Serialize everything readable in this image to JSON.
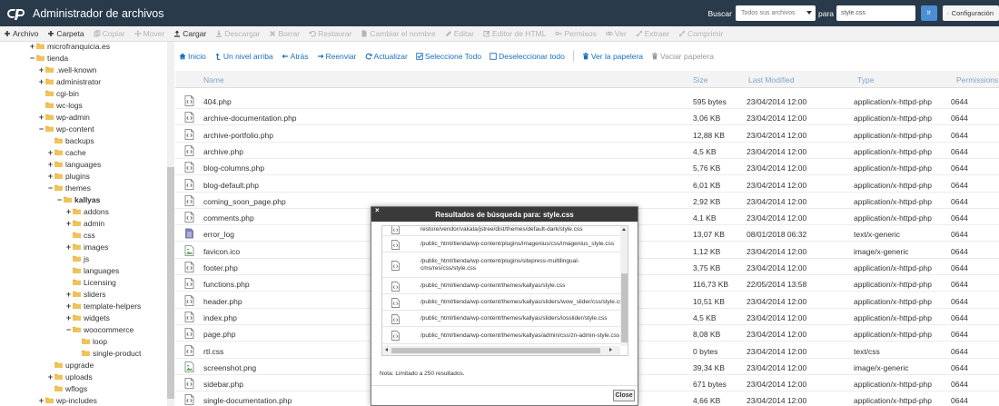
{
  "header": {
    "title": "Administrador de archivos",
    "search_label": "Buscar",
    "search_scope": "Todos sus archivos",
    "para_label": "para",
    "search_value": "style.css",
    "go_label": "Ir",
    "config_label": "Configuración"
  },
  "toolbar": [
    {
      "label": "Archivo",
      "icon": "plus-icon",
      "enabled": true
    },
    {
      "label": "Carpeta",
      "icon": "plus-icon",
      "enabled": true
    },
    {
      "label": "Copiar",
      "icon": "copy-icon",
      "enabled": false
    },
    {
      "label": "Mover",
      "icon": "move-icon",
      "enabled": false
    },
    {
      "label": "Cargar",
      "icon": "upload-icon",
      "enabled": true
    },
    {
      "label": "Descargar",
      "icon": "download-icon",
      "enabled": false
    },
    {
      "label": "Borrar",
      "icon": "x-icon",
      "enabled": false
    },
    {
      "label": "Restaurar",
      "icon": "undo-icon",
      "enabled": false
    },
    {
      "label": "Cambiar el nombre",
      "icon": "file-icon",
      "enabled": false
    },
    {
      "label": "Editar",
      "icon": "pencil-icon",
      "enabled": false
    },
    {
      "label": "Editor de HTML",
      "icon": "edit-box-icon",
      "enabled": false
    },
    {
      "label": "Permisos",
      "icon": "key-icon",
      "enabled": false
    },
    {
      "label": "Ver",
      "icon": "eye-icon",
      "enabled": false
    },
    {
      "label": "Extraer",
      "icon": "expand-icon",
      "enabled": false
    },
    {
      "label": "Comprimir",
      "icon": "compress-icon",
      "enabled": false
    }
  ],
  "tree": [
    {
      "label": "microfranquicia.es",
      "toggle": "+",
      "indent": 0
    },
    {
      "label": "tienda",
      "toggle": "−",
      "indent": 0
    },
    {
      "label": ".well-known",
      "toggle": "+",
      "indent": 1
    },
    {
      "label": "administrator",
      "toggle": "+",
      "indent": 1
    },
    {
      "label": "cgi-bin",
      "toggle": "",
      "indent": 1
    },
    {
      "label": "wc-logs",
      "toggle": "",
      "indent": 1
    },
    {
      "label": "wp-admin",
      "toggle": "+",
      "indent": 1
    },
    {
      "label": "wp-content",
      "toggle": "−",
      "indent": 1
    },
    {
      "label": "backups",
      "toggle": "",
      "indent": 2
    },
    {
      "label": "cache",
      "toggle": "+",
      "indent": 2
    },
    {
      "label": "languages",
      "toggle": "+",
      "indent": 2
    },
    {
      "label": "plugins",
      "toggle": "+",
      "indent": 2
    },
    {
      "label": "themes",
      "toggle": "−",
      "indent": 2
    },
    {
      "label": "kallyas",
      "toggle": "−",
      "indent": 3,
      "bold": true
    },
    {
      "label": "addons",
      "toggle": "+",
      "indent": 4
    },
    {
      "label": "admin",
      "toggle": "+",
      "indent": 4
    },
    {
      "label": "css",
      "toggle": "",
      "indent": 4
    },
    {
      "label": "images",
      "toggle": "+",
      "indent": 4
    },
    {
      "label": "js",
      "toggle": "",
      "indent": 4
    },
    {
      "label": "languages",
      "toggle": "",
      "indent": 4
    },
    {
      "label": "Licensing",
      "toggle": "",
      "indent": 4
    },
    {
      "label": "sliders",
      "toggle": "+",
      "indent": 4
    },
    {
      "label": "template-helpers",
      "toggle": "+",
      "indent": 4
    },
    {
      "label": "widgets",
      "toggle": "+",
      "indent": 4
    },
    {
      "label": "woocommerce",
      "toggle": "−",
      "indent": 4
    },
    {
      "label": "loop",
      "toggle": "",
      "indent": 5
    },
    {
      "label": "single-product",
      "toggle": "",
      "indent": 5
    },
    {
      "label": "upgrade",
      "toggle": "",
      "indent": 2
    },
    {
      "label": "uploads",
      "toggle": "+",
      "indent": 2
    },
    {
      "label": "wflogs",
      "toggle": "",
      "indent": 2
    },
    {
      "label": "wp-includes",
      "toggle": "+",
      "indent": 1
    }
  ],
  "pane_toolbar": [
    {
      "label": "Inicio",
      "icon": "home-icon",
      "enabled": true
    },
    {
      "label": "Un nivel arriba",
      "icon": "level-up-icon",
      "enabled": true
    },
    {
      "label": "Atrás",
      "icon": "arrow-left-icon",
      "enabled": true
    },
    {
      "label": "Reenviar",
      "icon": "arrow-right-icon",
      "enabled": true
    },
    {
      "label": "Actualizar",
      "icon": "refresh-icon",
      "enabled": true
    },
    {
      "label": "Seleccione Todo",
      "icon": "checkbox-checked-icon",
      "enabled": true
    },
    {
      "label": "Deseleccionar todo",
      "icon": "checkbox-empty-icon",
      "enabled": true
    },
    {
      "label": "Ver la papelera",
      "icon": "trash-icon",
      "enabled": true
    },
    {
      "label": "Vaciar papelera",
      "icon": "trash-icon",
      "enabled": false
    }
  ],
  "columns": {
    "name": "Name",
    "size": "Size",
    "modified": "Last Modified",
    "type": "Type",
    "permissions": "Permissions"
  },
  "files": [
    {
      "name": "404.php",
      "size": "595 bytes",
      "modified": "23/04/2014 12:00",
      "type": "application/x-httpd-php",
      "perm": "0644",
      "kind": "code"
    },
    {
      "name": "archive-documentation.php",
      "size": "3,06 KB",
      "modified": "23/04/2014 12:00",
      "type": "application/x-httpd-php",
      "perm": "0644",
      "kind": "code"
    },
    {
      "name": "archive-portfolio.php",
      "size": "12,88 KB",
      "modified": "23/04/2014 12:00",
      "type": "application/x-httpd-php",
      "perm": "0644",
      "kind": "code"
    },
    {
      "name": "archive.php",
      "size": "4,5 KB",
      "modified": "23/04/2014 12:00",
      "type": "application/x-httpd-php",
      "perm": "0644",
      "kind": "code"
    },
    {
      "name": "blog-columns.php",
      "size": "5,76 KB",
      "modified": "23/04/2014 12:00",
      "type": "application/x-httpd-php",
      "perm": "0644",
      "kind": "code"
    },
    {
      "name": "blog-default.php",
      "size": "6,01 KB",
      "modified": "23/04/2014 12:00",
      "type": "application/x-httpd-php",
      "perm": "0644",
      "kind": "code"
    },
    {
      "name": "coming_soon_page.php",
      "size": "2,92 KB",
      "modified": "23/04/2014 12:00",
      "type": "application/x-httpd-php",
      "perm": "0644",
      "kind": "code"
    },
    {
      "name": "comments.php",
      "size": "4,1 KB",
      "modified": "23/04/2014 12:00",
      "type": "application/x-httpd-php",
      "perm": "0644",
      "kind": "code"
    },
    {
      "name": "error_log",
      "size": "13,07 KB",
      "modified": "08/01/2018 06:32",
      "type": "text/x-generic",
      "perm": "0644",
      "kind": "text"
    },
    {
      "name": "favicon.ico",
      "size": "1,12 KB",
      "modified": "23/04/2014 12:00",
      "type": "image/x-generic",
      "perm": "0644",
      "kind": "image"
    },
    {
      "name": "footer.php",
      "size": "3,75 KB",
      "modified": "23/04/2014 12:00",
      "type": "application/x-httpd-php",
      "perm": "0644",
      "kind": "code"
    },
    {
      "name": "functions.php",
      "size": "116,73 KB",
      "modified": "22/05/2014 13:58",
      "type": "application/x-httpd-php",
      "perm": "0644",
      "kind": "code"
    },
    {
      "name": "header.php",
      "size": "10,51 KB",
      "modified": "23/04/2014 12:00",
      "type": "application/x-httpd-php",
      "perm": "0644",
      "kind": "code"
    },
    {
      "name": "index.php",
      "size": "4,5 KB",
      "modified": "23/04/2014 12:00",
      "type": "application/x-httpd-php",
      "perm": "0644",
      "kind": "code"
    },
    {
      "name": "page.php",
      "size": "8,08 KB",
      "modified": "23/04/2014 12:00",
      "type": "application/x-httpd-php",
      "perm": "0644",
      "kind": "code"
    },
    {
      "name": "rtl.css",
      "size": "0 bytes",
      "modified": "23/04/2014 12:00",
      "type": "text/css",
      "perm": "0644",
      "kind": "code"
    },
    {
      "name": "screenshot.png",
      "size": "39,34 KB",
      "modified": "23/04/2014 12:00",
      "type": "image/x-generic",
      "perm": "0644",
      "kind": "image"
    },
    {
      "name": "sidebar.php",
      "size": "671 bytes",
      "modified": "23/04/2014 12:00",
      "type": "application/x-httpd-php",
      "perm": "0644",
      "kind": "code"
    },
    {
      "name": "single-documentation.php",
      "size": "4,66 KB",
      "modified": "23/04/2014 12:00",
      "type": "application/x-httpd-php",
      "perm": "0644",
      "kind": "code"
    }
  ],
  "modal": {
    "close_x": "×",
    "title": "Resultados de búsqueda para: style.css",
    "results": [
      {
        "path": "restore/vendor/vakata/jstree/dist/themes/default-dark/style.css"
      },
      {
        "path": "/public_html/tienda/wp-content/plugins/imagenius/css/imagenius_style.css"
      },
      {
        "path": "/public_html/tienda/wp-content/plugins/sitepress-multilingual-cms/res/css/style.css",
        "wrap": true
      },
      {
        "path": "/public_html/tienda/wp-content/themes/kallyas/style.css"
      },
      {
        "path": "/public_html/tienda/wp-content/themes/kallyas/sliders/wow_slider/css/style.css"
      },
      {
        "path": "/public_html/tienda/wp-content/themes/kallyas/sliders/iosslider/style.css"
      },
      {
        "path": "/public_html/tienda/wp-content/themes/kallyas/admin/css/zn-admin-style.css"
      }
    ],
    "note": "Nota: Limitado a 250 resultados.",
    "close_label": "Close"
  }
}
